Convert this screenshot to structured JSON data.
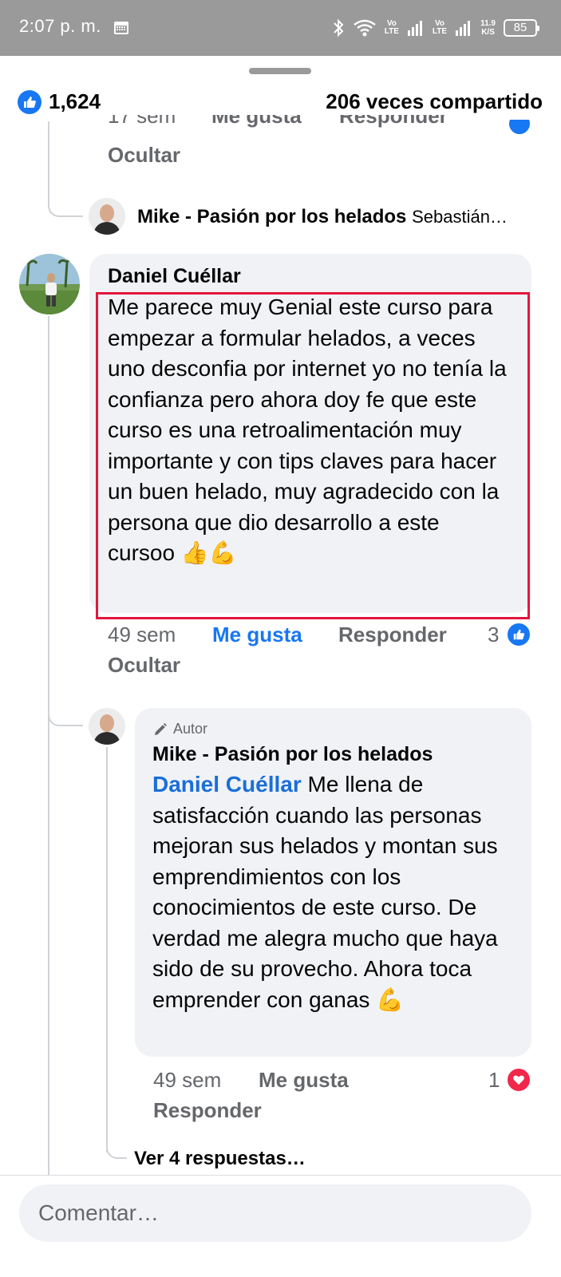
{
  "status_bar": {
    "time": "2:07 p. m.",
    "net1": "Vo\nLTE",
    "net2": "Vo\nLTE",
    "speed": "11.9\nK/S",
    "battery": "85"
  },
  "post_stats": {
    "likes": "1,624",
    "shares": "206 veces compartido"
  },
  "prev_comment": {
    "hide_label": "Ocultar",
    "reply_preview_name": "Mike - Pasión por los helados",
    "reply_preview_text": "Sebastián…"
  },
  "comment": {
    "author": "Daniel Cuéllar",
    "text": "Me parece muy Genial este curso para empezar a formular helados, a veces uno desconfia por internet yo no tenía la confianza pero ahora doy fe que este curso es una retroalimentación muy importante y con tips claves para hacer un buen helado, muy agradecido con la persona que dio desarrollo a este cursoo 👍💪",
    "time": "49 sem",
    "like_label": "Me gusta",
    "reply_label": "Responder",
    "reaction_count": "3",
    "hide_label": "Ocultar"
  },
  "reply": {
    "badge": "Autor",
    "author": "Mike - Pasión por los helados",
    "mention": "Daniel Cuéllar",
    "text": " Me llena de satisfacción cuando las personas mejoran sus helados y montan sus emprendimientos con los conocimientos de este curso. De verdad me alegra mucho que haya sido de su provecho. Ahora toca emprender con ganas 💪",
    "time": "49 sem",
    "like_label": "Me gusta",
    "reply_label": "Responder",
    "reaction_count": "1"
  },
  "more_replies": "Ver 4 respuestas…",
  "composer": {
    "placeholder": "Comentar…"
  },
  "colors": {
    "facebook_blue": "#1877f2",
    "highlight_red": "#e3173e",
    "love_red": "#f0284a"
  }
}
